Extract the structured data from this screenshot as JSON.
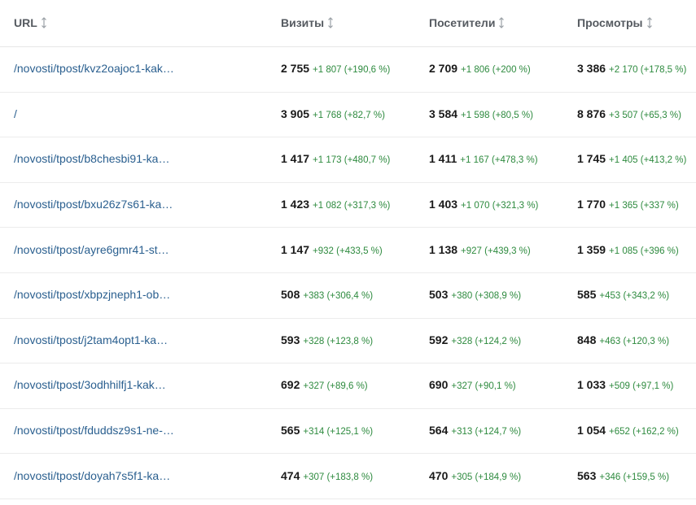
{
  "header": {
    "url": "URL",
    "visits": "Визиты",
    "visitors": "Посетители",
    "views": "Просмотры"
  },
  "rows": [
    {
      "url": "/novosti/tpost/kvz2oajoc1-kak…",
      "visits": "2 755",
      "visits_delta": "+1 807 (+190,6 %)",
      "visitors": "2 709",
      "visitors_delta": "+1 806 (+200 %)",
      "views": "3 386",
      "views_delta": "+2 170 (+178,5 %)"
    },
    {
      "url": "/",
      "visits": "3 905",
      "visits_delta": "+1 768 (+82,7 %)",
      "visitors": "3 584",
      "visitors_delta": "+1 598 (+80,5 %)",
      "views": "8 876",
      "views_delta": "+3 507 (+65,3 %)"
    },
    {
      "url": "/novosti/tpost/b8chesbi91-ka…",
      "visits": "1 417",
      "visits_delta": "+1 173 (+480,7 %)",
      "visitors": "1 411",
      "visitors_delta": "+1 167 (+478,3 %)",
      "views": "1 745",
      "views_delta": "+1 405 (+413,2 %)"
    },
    {
      "url": "/novosti/tpost/bxu26z7s61-ka…",
      "visits": "1 423",
      "visits_delta": "+1 082 (+317,3 %)",
      "visitors": "1 403",
      "visitors_delta": "+1 070 (+321,3 %)",
      "views": "1 770",
      "views_delta": "+1 365 (+337 %)"
    },
    {
      "url": "/novosti/tpost/ayre6gmr41-st…",
      "visits": "1 147",
      "visits_delta": "+932 (+433,5 %)",
      "visitors": "1 138",
      "visitors_delta": "+927 (+439,3 %)",
      "views": "1 359",
      "views_delta": "+1 085 (+396 %)"
    },
    {
      "url": "/novosti/tpost/xbpzjneph1-ob…",
      "visits": "508",
      "visits_delta": "+383 (+306,4 %)",
      "visitors": "503",
      "visitors_delta": "+380 (+308,9 %)",
      "views": "585",
      "views_delta": "+453 (+343,2 %)"
    },
    {
      "url": "/novosti/tpost/j2tam4opt1-ka…",
      "visits": "593",
      "visits_delta": "+328 (+123,8 %)",
      "visitors": "592",
      "visitors_delta": "+328 (+124,2 %)",
      "views": "848",
      "views_delta": "+463 (+120,3 %)"
    },
    {
      "url": "/novosti/tpost/3odhhilfj1-kak…",
      "visits": "692",
      "visits_delta": "+327 (+89,6 %)",
      "visitors": "690",
      "visitors_delta": "+327 (+90,1 %)",
      "views": "1 033",
      "views_delta": "+509 (+97,1 %)"
    },
    {
      "url": "/novosti/tpost/fduddsz9s1-ne-…",
      "visits": "565",
      "visits_delta": "+314 (+125,1 %)",
      "visitors": "564",
      "visitors_delta": "+313 (+124,7 %)",
      "views": "1 054",
      "views_delta": "+652 (+162,2 %)"
    },
    {
      "url": "/novosti/tpost/doyah7s5f1-ka…",
      "visits": "474",
      "visits_delta": "+307 (+183,8 %)",
      "visitors": "470",
      "visitors_delta": "+305 (+184,9 %)",
      "views": "563",
      "views_delta": "+346 (+159,5 %)"
    }
  ],
  "colors": {
    "link": "#2a5f8f",
    "delta": "#2d8a3e",
    "header_text": "#555a60"
  },
  "icons": {
    "sort": "sort-updown-icon"
  }
}
